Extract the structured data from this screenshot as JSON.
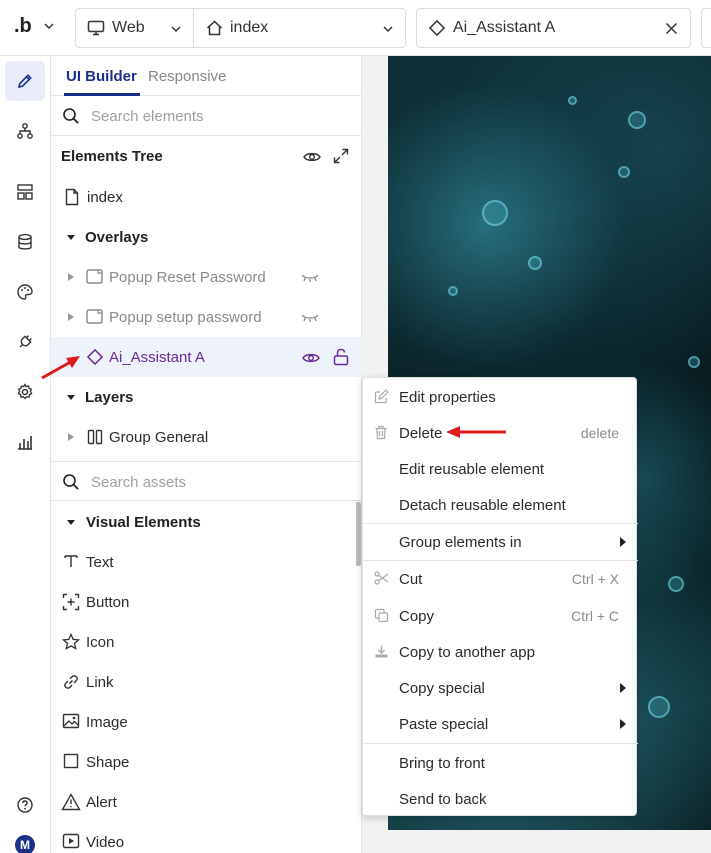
{
  "topbar": {
    "logo": ".b",
    "platform": "Web",
    "page": "index",
    "element": "Ai_Assistant A"
  },
  "panel": {
    "tab_builder": "UI Builder",
    "tab_responsive": "Responsive",
    "search_elements_placeholder": "Search elements",
    "tree_title": "Elements Tree",
    "tree": {
      "index": "index",
      "overlays": "Overlays",
      "popup_reset": "Popup Reset Password",
      "popup_setup": "Popup setup password",
      "ai_assistant": "Ai_Assistant A",
      "layers": "Layers",
      "group_general": "Group General"
    },
    "search_assets_placeholder": "Search assets",
    "visual_elements": "Visual Elements",
    "assets": [
      "Text",
      "Button",
      "Icon",
      "Link",
      "Image",
      "Shape",
      "Alert",
      "Video"
    ]
  },
  "user": {
    "avatar_initial": "M"
  },
  "context_menu": {
    "items": [
      {
        "label": "Edit properties",
        "shortcut": ""
      },
      {
        "label": "Delete",
        "shortcut": "delete"
      },
      {
        "label": "Edit reusable element",
        "shortcut": ""
      },
      {
        "label": "Detach reusable element",
        "shortcut": ""
      },
      {
        "label": "Group elements in",
        "shortcut": ""
      },
      {
        "label": "Cut",
        "shortcut": "Ctrl + X"
      },
      {
        "label": "Copy",
        "shortcut": "Ctrl + C"
      },
      {
        "label": "Copy to another app",
        "shortcut": ""
      },
      {
        "label": "Copy special",
        "shortcut": ""
      },
      {
        "label": "Paste special",
        "shortcut": ""
      },
      {
        "label": "Bring to front",
        "shortcut": ""
      },
      {
        "label": "Send to back",
        "shortcut": ""
      }
    ]
  },
  "colors": {
    "accent": "#1c2f8a",
    "selected_text": "#6b2a95",
    "annotation_arrow": "#e01b1b"
  }
}
